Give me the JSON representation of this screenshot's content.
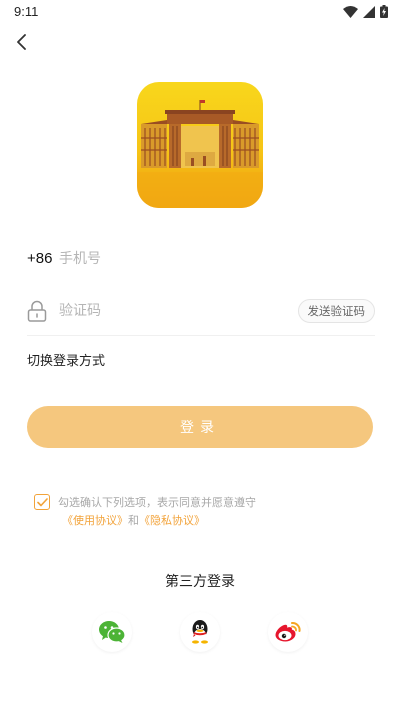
{
  "status_bar": {
    "time": "9:11",
    "icons": [
      "wifi-icon",
      "cellular-icon",
      "battery-charging-icon"
    ]
  },
  "header": {
    "back_icon": "chevron-left-icon"
  },
  "logo": {
    "icon": "gate-building-logo",
    "colors": {
      "top": "#f7d11a",
      "bottom": "#f0a010",
      "building": "#a0522d"
    }
  },
  "phone": {
    "country_code": "+86",
    "placeholder": "手机号",
    "value": ""
  },
  "code": {
    "icon": "lock-icon",
    "placeholder": "验证码",
    "value": "",
    "send_label": "发送验证码"
  },
  "switch_login_label": "切换登录方式",
  "login_button_label": "登录",
  "agreement": {
    "checked": true,
    "text": "勾选确认下列选项，表示同意并愿意遵守",
    "terms_label": "《使用协议》",
    "and_label": "和",
    "privacy_label": "《隐私协议》"
  },
  "third_party": {
    "title": "第三方登录",
    "providers": [
      {
        "icon": "wechat-icon",
        "color": "#4cb336"
      },
      {
        "icon": "qq-icon",
        "color": "#1a1a1a"
      },
      {
        "icon": "weibo-icon",
        "color": "#e6162d"
      }
    ]
  },
  "colors": {
    "accent": "#f2a33a",
    "login_button": "#f5c77e",
    "placeholder": "#b5b5b5"
  }
}
